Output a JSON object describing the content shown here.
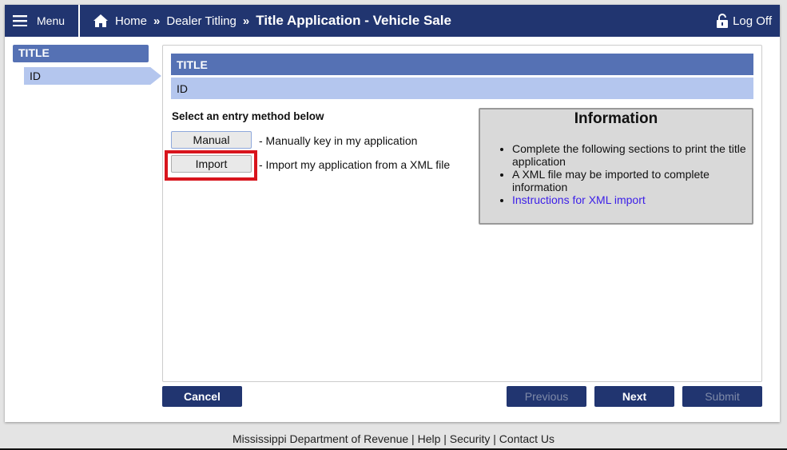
{
  "header": {
    "menu_label": "Menu",
    "breadcrumb": [
      "Home",
      "Dealer Titling"
    ],
    "sep": "»",
    "current": "Title Application - Vehicle Sale",
    "logoff_label": "Log Off"
  },
  "sidebar": {
    "section": "TITLE",
    "item": "ID"
  },
  "main": {
    "section": "TITLE",
    "subsection": "ID",
    "prompt": "Select an entry method below",
    "options": [
      {
        "label": "Manual",
        "desc": "- Manually key in my application"
      },
      {
        "label": "Import",
        "desc": "- Import my application from a XML file"
      }
    ],
    "info": {
      "title": "Information",
      "items": [
        "Complete the following sections to print the title application",
        "A XML file may be imported to complete information"
      ],
      "link": "Instructions for XML import"
    }
  },
  "buttons": {
    "cancel": "Cancel",
    "previous": "Previous",
    "next": "Next",
    "submit": "Submit"
  },
  "footer": {
    "links": [
      "Mississippi Department of Revenue",
      "Help",
      "Security",
      "Contact Us"
    ],
    "divider": "|"
  },
  "colors": {
    "header": "#213570",
    "section": "#5571b4",
    "subsection": "#b4c6ee",
    "highlight": "#d8141c",
    "link": "#3b1ee8"
  }
}
